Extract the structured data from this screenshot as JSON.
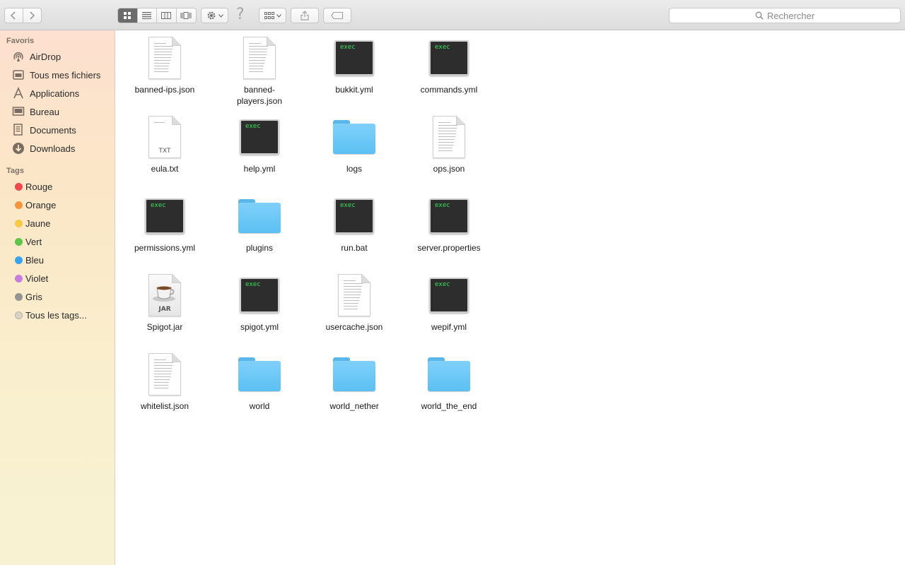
{
  "toolbar": {
    "back_icon": "chevron-left-icon",
    "forward_icon": "chevron-right-icon",
    "view_modes": [
      "icon-view",
      "list-view",
      "column-view",
      "cover-flow-view"
    ],
    "help_glyph": "?",
    "search_placeholder": "Rechercher"
  },
  "sidebar": {
    "favorites_header": "Favoris",
    "favorites": [
      {
        "label": "AirDrop",
        "icon": "airdrop-icon"
      },
      {
        "label": "Tous mes fichiers",
        "icon": "all-files-icon"
      },
      {
        "label": "Applications",
        "icon": "applications-icon"
      },
      {
        "label": "Bureau",
        "icon": "desktop-icon"
      },
      {
        "label": "Documents",
        "icon": "documents-icon"
      },
      {
        "label": "Downloads",
        "icon": "downloads-icon"
      }
    ],
    "tags_header": "Tags",
    "tags": [
      {
        "label": "Rouge",
        "color": "#f0484b"
      },
      {
        "label": "Orange",
        "color": "#f5953e"
      },
      {
        "label": "Jaune",
        "color": "#f7c945"
      },
      {
        "label": "Vert",
        "color": "#5fc549"
      },
      {
        "label": "Bleu",
        "color": "#3aa3ee"
      },
      {
        "label": "Violet",
        "color": "#c77ddd"
      },
      {
        "label": "Gris",
        "color": "#949494"
      },
      {
        "label": "Tous les tags...",
        "color": "#d8d3c8"
      }
    ]
  },
  "files": [
    {
      "name": "banned-ips.json",
      "type": "doc"
    },
    {
      "name": "banned-\nplayers.json",
      "type": "doc"
    },
    {
      "name": "bukkit.yml",
      "type": "exec"
    },
    {
      "name": "commands.yml",
      "type": "exec"
    },
    {
      "name": "eula.txt",
      "type": "txt"
    },
    {
      "name": "help.yml",
      "type": "exec"
    },
    {
      "name": "logs",
      "type": "folder"
    },
    {
      "name": "ops.json",
      "type": "doc"
    },
    {
      "name": "permissions.yml",
      "type": "exec"
    },
    {
      "name": "plugins",
      "type": "folder"
    },
    {
      "name": "run.bat",
      "type": "exec"
    },
    {
      "name": "server.properties",
      "type": "exec"
    },
    {
      "name": "Spigot.jar",
      "type": "jar"
    },
    {
      "name": "spigot.yml",
      "type": "exec"
    },
    {
      "name": "usercache.json",
      "type": "doc"
    },
    {
      "name": "wepif.yml",
      "type": "exec"
    },
    {
      "name": "whitelist.json",
      "type": "doc"
    },
    {
      "name": "world",
      "type": "folder"
    },
    {
      "name": "world_nether",
      "type": "folder"
    },
    {
      "name": "world_the_end",
      "type": "folder"
    }
  ],
  "icon_text": {
    "exec": "exec",
    "txt": "TXT",
    "jar": "JAR"
  }
}
